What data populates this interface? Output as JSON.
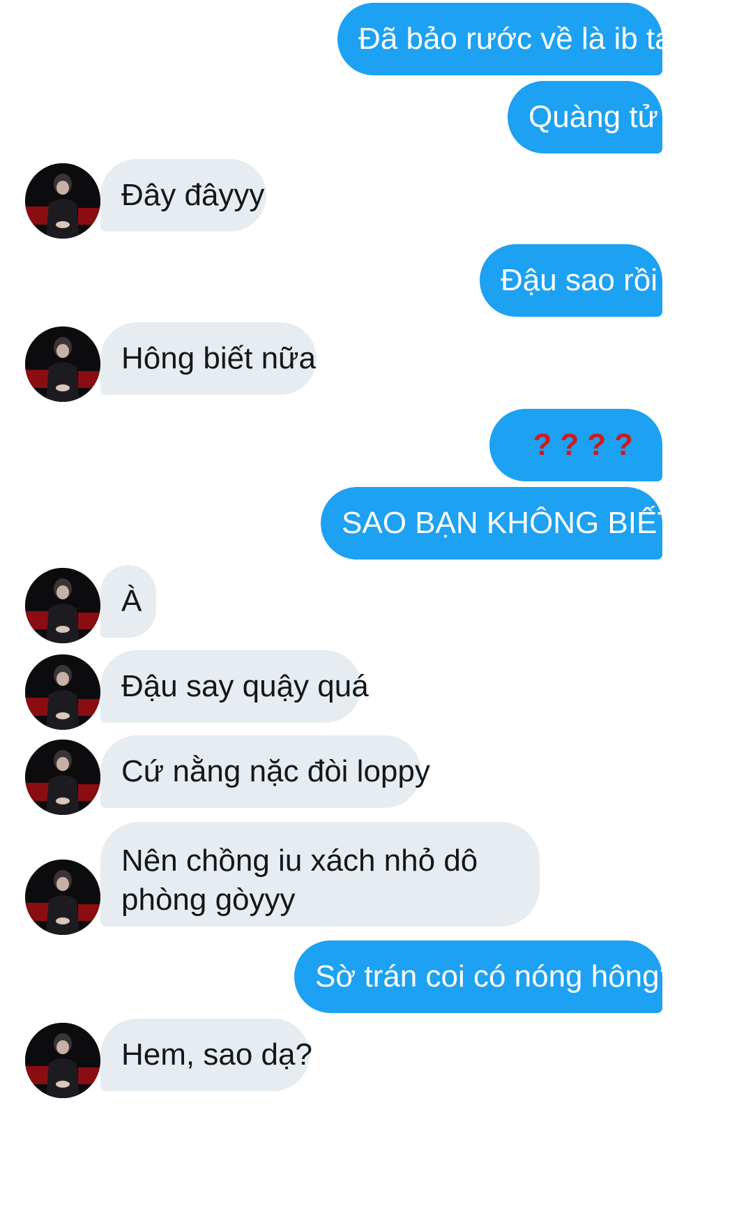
{
  "conversation": {
    "messages": [
      {
        "dir": "out",
        "text": "Đã bảo rước về là ib tao"
      },
      {
        "dir": "out",
        "text": "Quàng tử"
      },
      {
        "dir": "in",
        "text": "Đây đâyyy"
      },
      {
        "dir": "out",
        "text": "Đậu sao rồi"
      },
      {
        "dir": "in",
        "text": "Hông biết nữa"
      },
      {
        "dir": "out",
        "text": "????"
      },
      {
        "dir": "out",
        "text": "SAO BẠN KHÔNG BIẾT?"
      },
      {
        "dir": "in",
        "text": "À"
      },
      {
        "dir": "in",
        "text": "Đậu say quậy quá"
      },
      {
        "dir": "in",
        "text": "Cứ nằng nặc đòi loppy"
      },
      {
        "dir": "in",
        "text": "Nên chồng iu xách nhỏ dô phòng gòyyy"
      },
      {
        "dir": "out",
        "text": "Sờ trán coi có nóng hông?"
      },
      {
        "dir": "in",
        "text": "Hem, sao dạ?"
      }
    ]
  },
  "colors": {
    "outgoing_bubble": "#1da1f2",
    "incoming_bubble": "#e6ecf0",
    "question_marks": "#d0191c"
  },
  "icons": {
    "avatar": "contact-avatar-photo"
  }
}
